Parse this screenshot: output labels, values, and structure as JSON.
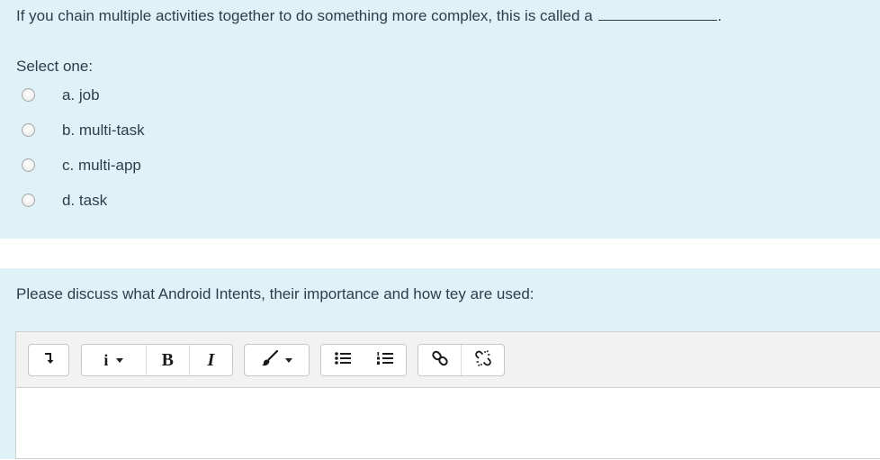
{
  "question1": {
    "text": "If you chain multiple activities together to do something more complex, this is called a",
    "end_punct": ".",
    "select_label": "Select one:",
    "options": [
      {
        "label": "a. job",
        "selected": false
      },
      {
        "label": "b. multi-task",
        "selected": false
      },
      {
        "label": "c. multi-app",
        "selected": false
      },
      {
        "label": "d. task",
        "selected": false
      }
    ]
  },
  "question2": {
    "text": "Please discuss what Android Intents, their importance and how tey are used:",
    "toolbar": {
      "toggle_icon": "arrow-down-return-icon",
      "info_label": "i",
      "bold_label": "B",
      "italic_label": "I",
      "style_icon": "paintbrush-icon",
      "bullet_list_icon": "bullet-list-icon",
      "numbered_list_icon": "numbered-list-icon",
      "link_icon": "link-icon",
      "unlink_icon": "unlink-icon"
    },
    "answer_text": ""
  },
  "colors": {
    "panel_background": "#def2f8",
    "text": "#2f3d4b",
    "toolbar_background": "#f2f2f2"
  }
}
